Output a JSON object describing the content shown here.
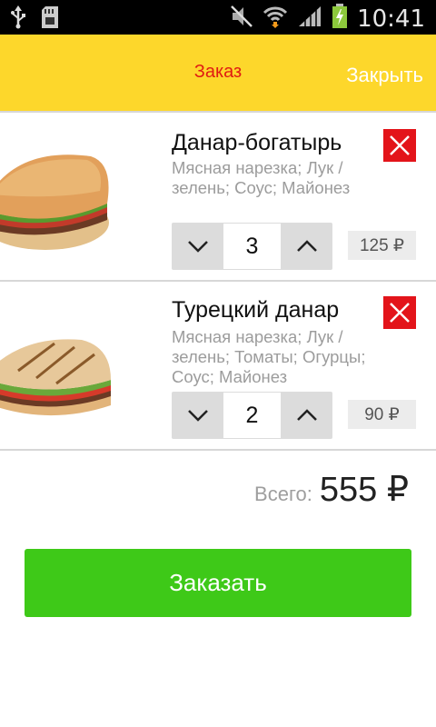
{
  "status_bar": {
    "time": "10:41",
    "icons": [
      "usb-icon",
      "sd-card-icon",
      "mute-icon",
      "wifi-icon",
      "signal-icon",
      "battery-charging-icon"
    ]
  },
  "header": {
    "title": "Заказ",
    "close_label": "Закрыть"
  },
  "items": [
    {
      "name": "Данар-богатырь",
      "description": "Мясная нарезка; Лук / зелень; Соус; Майонез",
      "quantity": "3",
      "price": "125 ₽"
    },
    {
      "name": "Турецкий данар",
      "description": "Мясная нарезка; Лук / зелень; Томаты; Огурцы; Соус; Майонез",
      "quantity": "2",
      "price": "90 ₽"
    }
  ],
  "total": {
    "label": "Всего:",
    "value": "555 ₽"
  },
  "order_button": {
    "label": "Заказать"
  },
  "colors": {
    "header_bg": "#fdd72b",
    "title_color": "#e01b12",
    "remove_bg": "#e3141a",
    "order_bg": "#3ec918"
  }
}
